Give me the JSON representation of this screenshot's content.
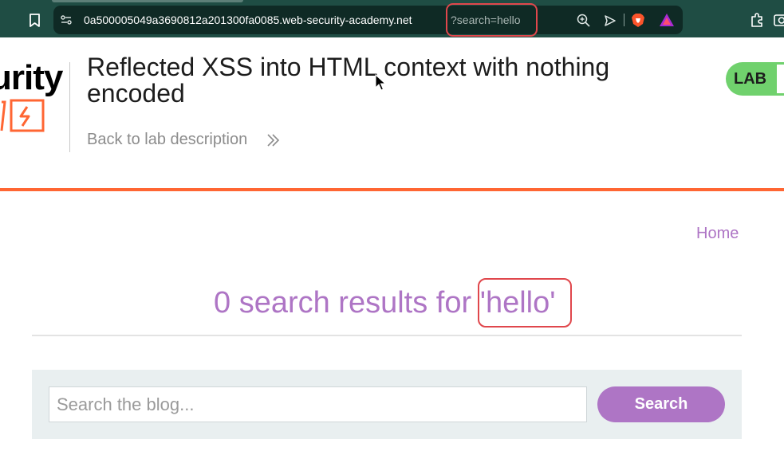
{
  "browser": {
    "url_host": "0a500005049a3690812a201300fa0085.web-security-academy.net",
    "url_query": "?search=hello"
  },
  "lab": {
    "logo_text": "urity",
    "title": "Reflected XSS into HTML context with nothing encoded",
    "back_link": "Back to lab description",
    "badge": "LAB"
  },
  "nav": {
    "home": "Home"
  },
  "results": {
    "heading": "0 search results for 'hello'"
  },
  "search": {
    "placeholder": "Search the blog...",
    "button": "Search"
  },
  "colors": {
    "accent": "#ae75c5",
    "highlight": "#e0474c",
    "rule": "#ff6633",
    "badge": "#70d16d"
  }
}
